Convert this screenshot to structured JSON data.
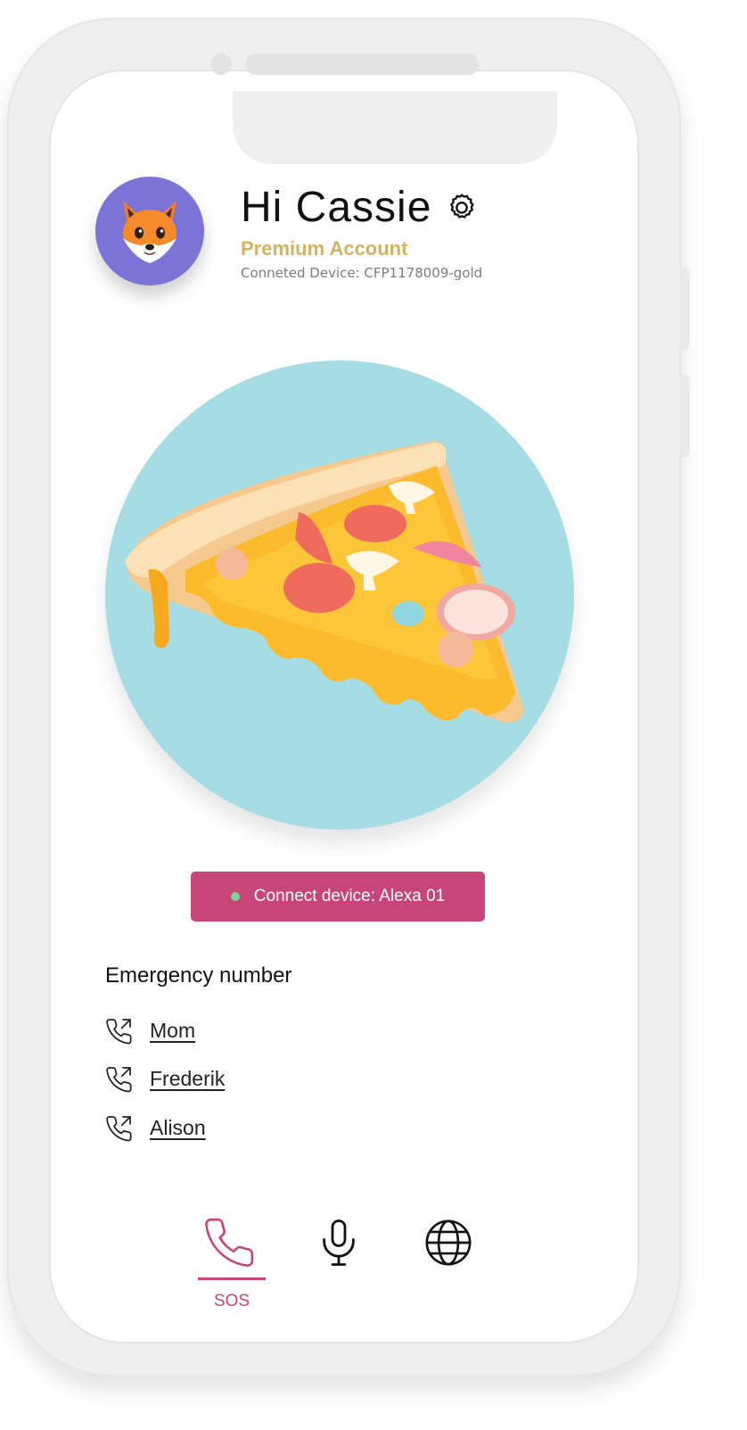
{
  "header": {
    "greeting": "Hi Cassie",
    "account_type": "Premium Account",
    "connected_device": "Conneted Device: CFP1178009-gold",
    "avatar_icon": "fox-emoji-icon",
    "settings_icon": "gear-icon"
  },
  "hero": {
    "image": "pizza-slice-illustration",
    "background_color": "#a6dde4"
  },
  "connect_button": {
    "label": "Connect device: Alexa 01",
    "status_color": "#7bd59a",
    "color": "#c8457a"
  },
  "emergency": {
    "title": "Emergency number",
    "contacts": [
      {
        "name": "Mom",
        "icon": "phone-outgoing-icon"
      },
      {
        "name": "Frederik",
        "icon": "phone-outgoing-icon"
      },
      {
        "name": "Alison",
        "icon": "phone-outgoing-icon"
      }
    ]
  },
  "nav": {
    "items": [
      {
        "id": "sos",
        "label": "SOS",
        "icon": "phone-icon",
        "active": true
      },
      {
        "id": "voice",
        "label": "",
        "icon": "microphone-icon",
        "active": false
      },
      {
        "id": "web",
        "label": "",
        "icon": "globe-icon",
        "active": false
      }
    ],
    "accent": "#c8457a"
  },
  "colors": {
    "gold": "#d2b362",
    "avatar_bg": "#7c73d6"
  }
}
